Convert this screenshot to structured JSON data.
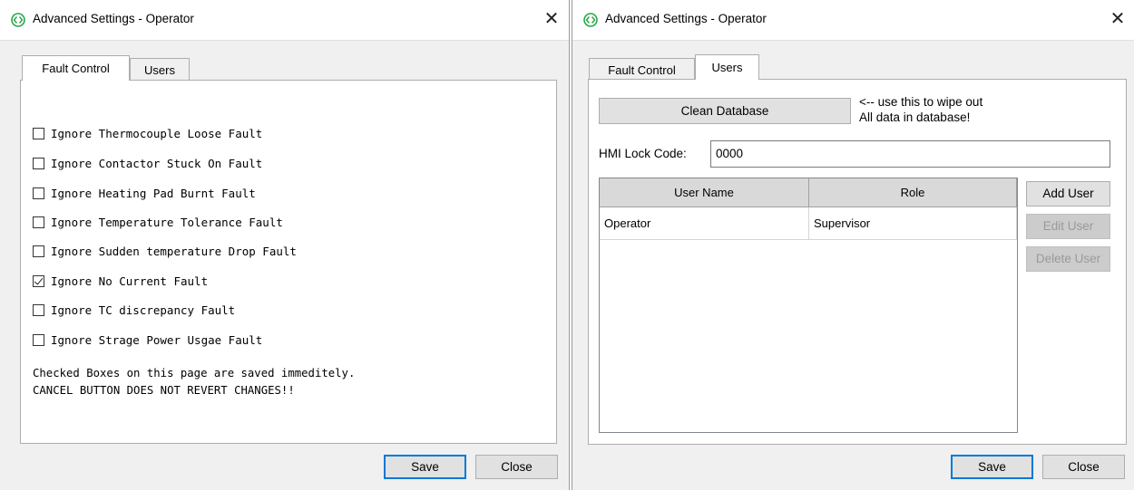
{
  "left_window": {
    "title": "Advanced Settings - Operator",
    "tabs": [
      {
        "label": "Fault Control",
        "active": true
      },
      {
        "label": "Users",
        "active": false
      }
    ],
    "checkboxes": [
      {
        "label": "Ignore Thermocouple Loose Fault",
        "checked": false
      },
      {
        "label": "Ignore Contactor Stuck On Fault",
        "checked": false
      },
      {
        "label": "Ignore Heating Pad Burnt Fault",
        "checked": false
      },
      {
        "label": "Ignore Temperature Tolerance Fault",
        "checked": false
      },
      {
        "label": "Ignore Sudden temperature Drop Fault",
        "checked": false
      },
      {
        "label": "Ignore No Current Fault",
        "checked": true
      },
      {
        "label": "Ignore TC discrepancy Fault",
        "checked": false
      },
      {
        "label": "Ignore Strage Power Usgae Fault",
        "checked": false
      }
    ],
    "note_line1": "Checked Boxes on this page are saved immeditely.",
    "note_line2": "CANCEL BUTTON DOES NOT REVERT CHANGES!!",
    "save_label": "Save",
    "close_label": "Close"
  },
  "right_window": {
    "title": "Advanced Settings - Operator",
    "tabs": [
      {
        "label": "Fault Control",
        "active": false
      },
      {
        "label": "Users",
        "active": true
      }
    ],
    "clean_db_label": "Clean Database",
    "hint_line1": "<-- use this to wipe out",
    "hint_line2": "All data in database!",
    "hmi_lock_label": "HMI Lock Code:",
    "hmi_lock_value": "0000",
    "grid": {
      "columns": [
        "User Name",
        "Role"
      ],
      "rows": [
        {
          "user_name": "Operator",
          "role": "Supervisor"
        }
      ]
    },
    "add_user_label": "Add User",
    "edit_user_label": "Edit User",
    "delete_user_label": "Delete User",
    "save_label": "Save",
    "close_label": "Close"
  },
  "colors": {
    "accent": "#0078d7",
    "icon_green": "#2aa84a"
  },
  "icons": {
    "app": "app-logo-icon",
    "close": "close-icon"
  }
}
